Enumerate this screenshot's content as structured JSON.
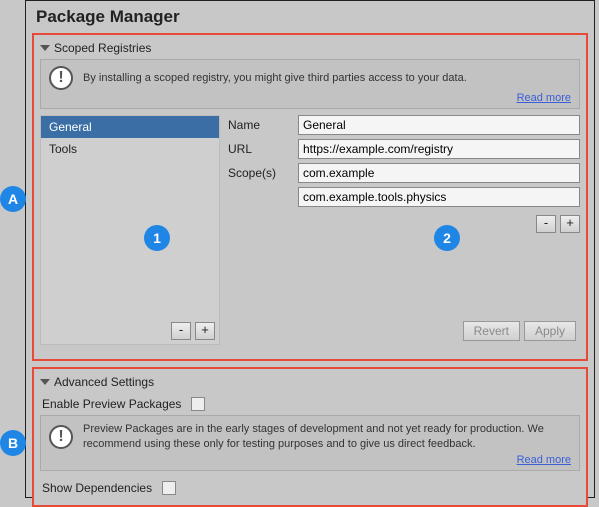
{
  "title": "Package Manager",
  "sections": {
    "scoped": {
      "header": "Scoped Registries",
      "warning": "By installing a scoped registry, you might give third parties access to your data.",
      "readmore": "Read more",
      "list": [
        "General",
        "Tools"
      ],
      "minus": "-",
      "plus": "+",
      "fields": {
        "nameLabel": "Name",
        "name": "General",
        "urlLabel": "URL",
        "url": "https://example.com/registry",
        "scopesLabel": "Scope(s)",
        "scope1": "com.example",
        "scope2": "com.example.tools.physics"
      },
      "revert": "Revert",
      "apply": "Apply"
    },
    "advanced": {
      "header": "Advanced Settings",
      "enablePreview": "Enable Preview Packages",
      "warning": "Preview Packages are in the early stages of development and not yet ready for production. We recommend using these only for testing purposes and to give us direct feedback.",
      "readmore": "Read more",
      "showDeps": "Show Dependencies"
    }
  },
  "markers": {
    "a": "A",
    "b": "B",
    "one": "1",
    "two": "2"
  }
}
